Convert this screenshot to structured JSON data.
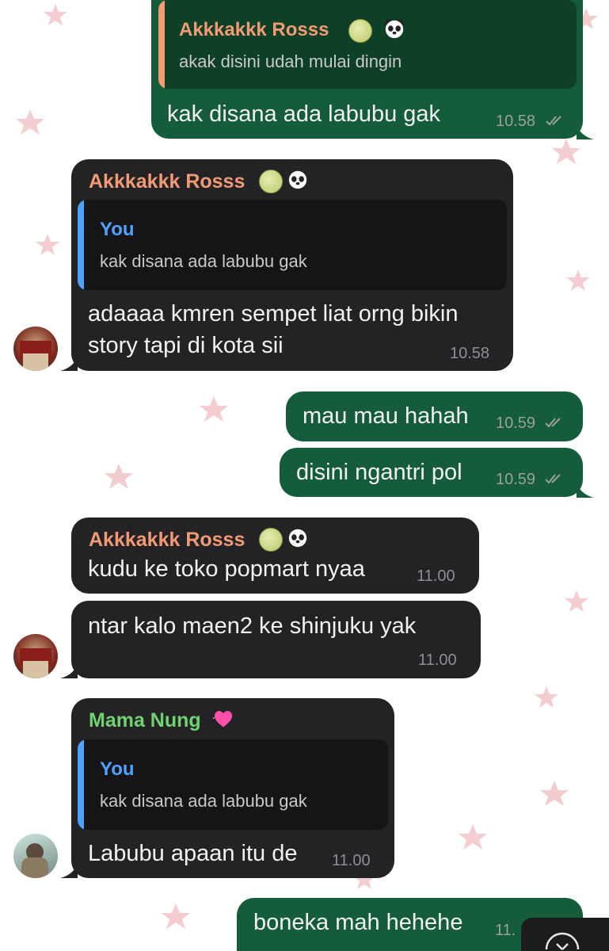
{
  "colors": {
    "outgoing_bubble": "#155c3a",
    "incoming_bubble": "#232326",
    "sender_orange": "#f29a73",
    "sender_green": "#6fd36d",
    "you_blue": "#4fa3ff"
  },
  "messages": [
    {
      "quote": {
        "sender": "Akkkakkk Rosss",
        "text": "akak disini udah mulai dingin"
      },
      "text": "kak disana ada labubu gak",
      "time": "10.58"
    },
    {
      "sender": "Akkkakkk Rosss",
      "quote": {
        "sender": "You",
        "text": "kak disana ada labubu gak"
      },
      "text_line1": "adaaaa kmren sempet liat orng bikin",
      "text_line2": "story tapi di kota sii",
      "time": "10.58"
    },
    {
      "text": "mau mau hahah",
      "time": "10.59"
    },
    {
      "text": "disini ngantri pol",
      "time": "10.59"
    },
    {
      "sender": "Akkkakkk Rosss",
      "text": "kudu ke toko popmart nyaa",
      "time": "11.00"
    },
    {
      "text": "ntar kalo maen2 ke shinjuku yak",
      "time": "11.00"
    },
    {
      "sender": "Mama Nung",
      "quote": {
        "sender": "You",
        "text": "kak disana ada labubu gak"
      },
      "text": "Labubu apaan itu de",
      "time": "11.00"
    },
    {
      "text": "boneka mah hehehe",
      "time": "11."
    }
  ]
}
